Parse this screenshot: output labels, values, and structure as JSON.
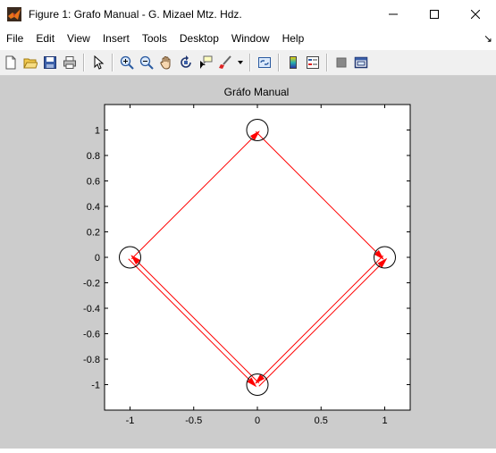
{
  "window": {
    "title": "Figure 1: Grafo Manual - G. Mizael Mtz. Hdz.",
    "minimize_symbol": "—",
    "maximize_symbol": "☐",
    "close_symbol": "✕"
  },
  "menu": {
    "items": [
      "File",
      "Edit",
      "View",
      "Insert",
      "Tools",
      "Desktop",
      "Window",
      "Help"
    ],
    "overflow_symbol": "↘"
  },
  "toolbar": {
    "icons": [
      "new-figure-icon",
      "open-file-icon",
      "save-icon",
      "print-icon",
      "select-arrow-icon",
      "zoom-in-icon",
      "zoom-out-icon",
      "pan-hand-icon",
      "rotate-3d-icon",
      "data-cursor-icon",
      "brush-icon",
      "link-plot-icon",
      "colorbar-icon",
      "legend-icon",
      "hide-plot-tools-icon",
      "show-plot-tools-icon"
    ]
  },
  "colors": {
    "edge": "#ff0000",
    "node": "#000000",
    "figure_bg": "#cccccc",
    "axes_bg": "#ffffff"
  },
  "chart_data": {
    "type": "scatter",
    "title": "Gráfo Manual",
    "xlabel": "",
    "ylabel": "",
    "xlim": [
      -1.2,
      1.2
    ],
    "ylim": [
      -1.2,
      1.2
    ],
    "xticks": [
      -1,
      -0.5,
      0,
      0.5,
      1
    ],
    "xtick_labels": [
      "-1",
      "-0.5",
      "0",
      "0.5",
      "1"
    ],
    "yticks": [
      1,
      0.8,
      0.6,
      0.4,
      0.2,
      0,
      -0.2,
      -0.4,
      -0.6,
      -0.8,
      -1
    ],
    "ytick_labels": [
      "1",
      "0.8",
      "0.6",
      "0.4",
      "0.2",
      "0",
      "-0.2",
      "-0.4",
      "-0.6",
      "-0.8",
      "-1"
    ],
    "grid": false,
    "nodes": [
      {
        "x": 0,
        "y": 1
      },
      {
        "x": -1,
        "y": 0
      },
      {
        "x": 1,
        "y": 0
      },
      {
        "x": 0,
        "y": -1
      }
    ],
    "edges": [
      {
        "from": [
          0,
          1
        ],
        "to": [
          1,
          0
        ]
      },
      {
        "from": [
          0,
          -1
        ],
        "to": [
          -1,
          0
        ]
      },
      {
        "from": [
          -1,
          0
        ],
        "to": [
          0,
          1
        ]
      },
      {
        "from": [
          1,
          0
        ],
        "to": [
          0,
          -1
        ]
      },
      {
        "from": [
          0,
          -1
        ],
        "to": [
          1,
          0
        ]
      },
      {
        "from": [
          -1,
          0
        ],
        "to": [
          0,
          -1
        ]
      }
    ]
  }
}
